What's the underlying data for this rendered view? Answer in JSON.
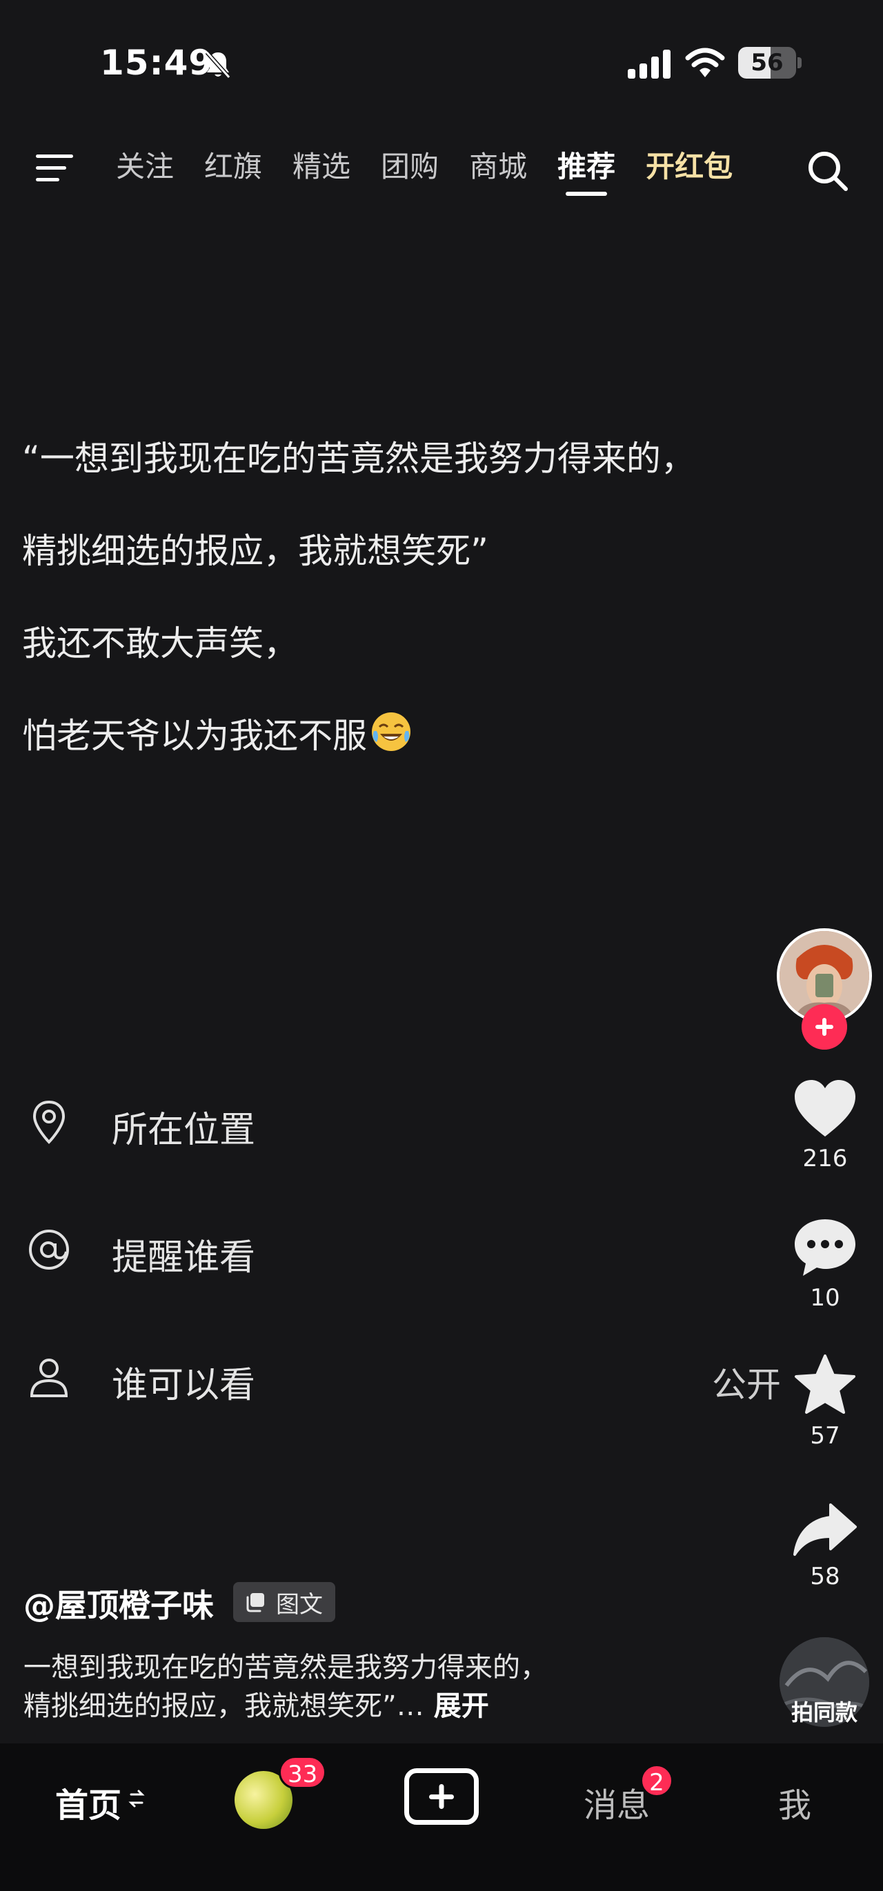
{
  "status_bar": {
    "time": "15:49",
    "battery": "56",
    "battery_level": 0.56,
    "icons": [
      "bell-slash-icon",
      "cellular-signal-icon",
      "wifi-icon",
      "battery-icon"
    ]
  },
  "top_nav": {
    "menu_icon": "menu-icon",
    "tabs": [
      {
        "label": "关注"
      },
      {
        "label": "红旗"
      },
      {
        "label": "精选"
      },
      {
        "label": "团购"
      },
      {
        "label": "商城"
      },
      {
        "label": "推荐",
        "active": true
      },
      {
        "label": "开红包",
        "promo": true
      }
    ],
    "search_icon": "search-icon"
  },
  "post": {
    "lines": [
      "“一想到我现在吃的苦竟然是我努力得来的，",
      "精挑细选的报应，我就想笑死”",
      "我还不敢大声笑，",
      "怕老天爷以为我还不服"
    ],
    "emoji": "crying-laughing-emoji"
  },
  "options": [
    {
      "icon": "location-pin-icon",
      "label": "所在位置",
      "value": ""
    },
    {
      "icon": "at-sign-icon",
      "label": "提醒谁看",
      "value": ""
    },
    {
      "icon": "person-icon",
      "label": "谁可以看",
      "value": "公开"
    }
  ],
  "actions": {
    "like_count": "216",
    "comment_count": "10",
    "favorite_count": "57",
    "share_count": "58",
    "same_style_label": "拍同款"
  },
  "author": {
    "name": "@屋顶橙子味",
    "badge": "图文"
  },
  "caption": {
    "line1": "一想到我现在吃的苦竟然是我努力得来的，",
    "line2": "精挑细选的报应，我就想笑死”…",
    "more": "展开"
  },
  "bottom_nav": {
    "home": "首页",
    "friends_badge": "33",
    "messages": "消息",
    "messages_badge": "2",
    "me": "我"
  },
  "colors": {
    "background": "#161618",
    "accent_red": "#fe2c55",
    "promo_gold": "#f6e1a6"
  }
}
